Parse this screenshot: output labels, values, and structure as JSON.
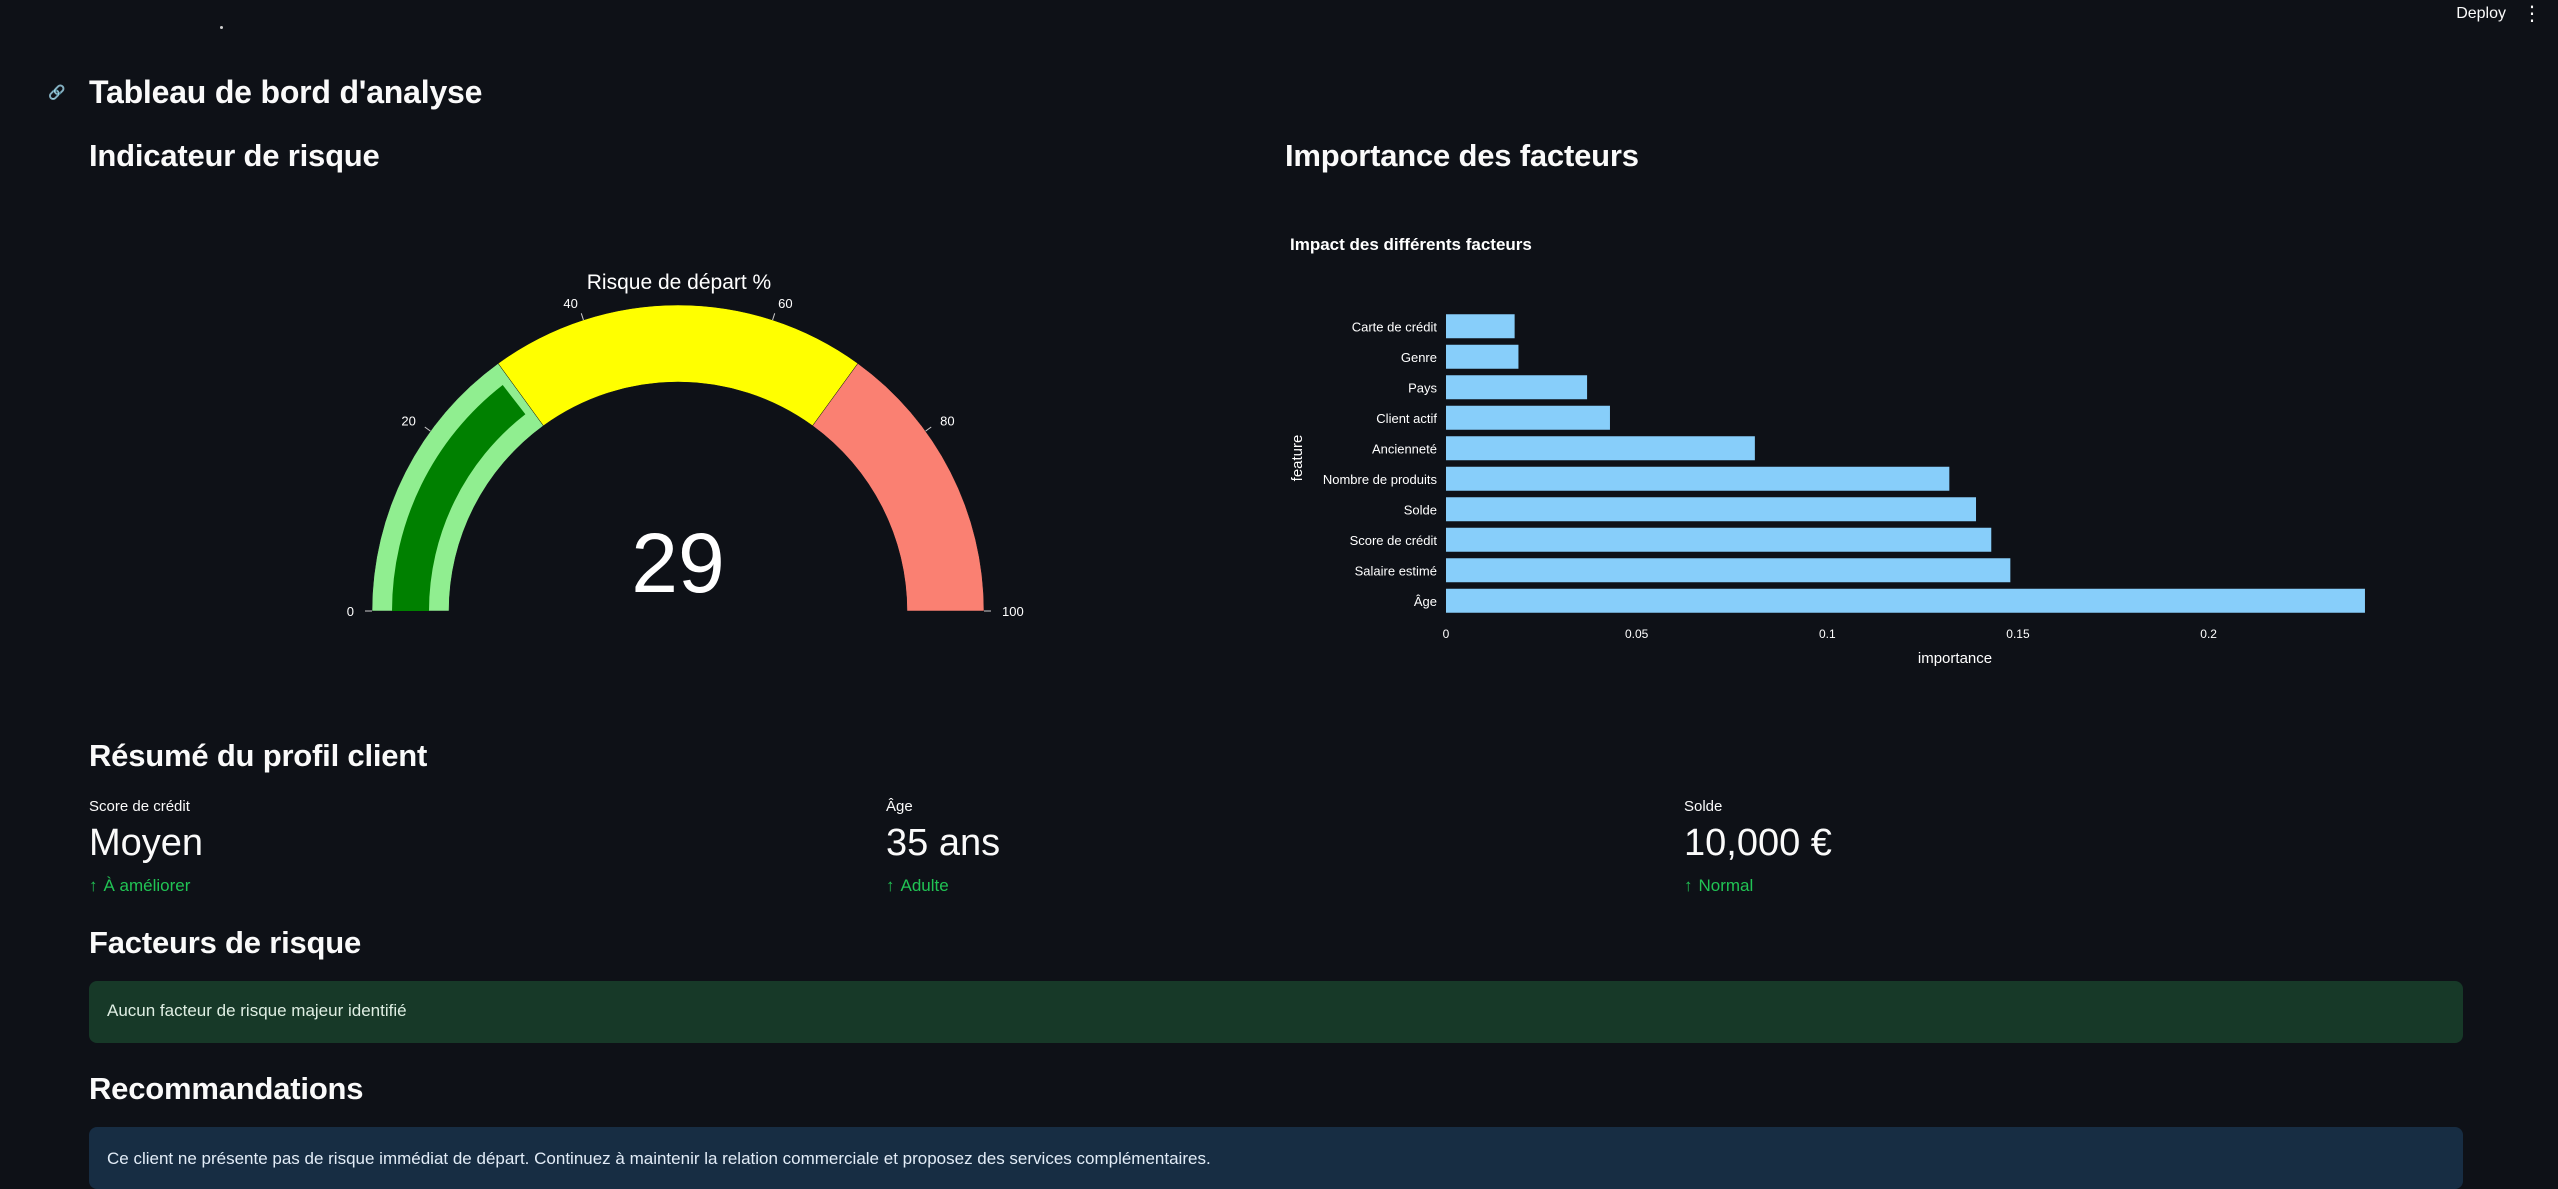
{
  "topbar": {
    "deploy_label": "Deploy",
    "menu_icon": "⋮"
  },
  "page": {
    "title": "Tableau de bord d'analyse"
  },
  "sections": {
    "risk": "Indicateur de risque",
    "importance": "Importance des facteurs",
    "profile": "Résumé du profil client",
    "risk_factors": "Facteurs de risque",
    "recommendations": "Recommandations"
  },
  "gauge": {
    "title": "Risque de départ %",
    "value": 29,
    "value_label": "29",
    "range": [
      0,
      100
    ],
    "ticks": [
      "0",
      "20",
      "40",
      "60",
      "80",
      "100"
    ],
    "tick_values": [
      0,
      20,
      40,
      60,
      80,
      100
    ],
    "bands": [
      {
        "from": 0,
        "to": 30,
        "color": "#90ee90"
      },
      {
        "from": 30,
        "to": 70,
        "color": "#ffff00"
      },
      {
        "from": 70,
        "to": 100,
        "color": "#fa8072"
      }
    ],
    "bar_color": "#008000"
  },
  "chart_data": {
    "type": "bar",
    "orientation": "horizontal",
    "title": "Impact des différents facteurs",
    "xlabel": "importance",
    "ylabel": "feature",
    "categories": [
      "Carte de crédit",
      "Genre",
      "Pays",
      "Client actif",
      "Ancienneté",
      "Nombre de produits",
      "Solde",
      "Score de crédit",
      "Salaire estimé",
      "Âge"
    ],
    "values": [
      0.018,
      0.019,
      0.037,
      0.043,
      0.081,
      0.132,
      0.139,
      0.143,
      0.148,
      0.241
    ],
    "xticks": [
      "0",
      "0.05",
      "0.1",
      "0.15",
      "0.2"
    ],
    "xtick_values": [
      0,
      0.05,
      0.1,
      0.15,
      0.2
    ],
    "xlim": [
      0,
      0.2536
    ],
    "bar_color": "#87cefa"
  },
  "profile": {
    "credit": {
      "label": "Score de crédit",
      "value": "Moyen",
      "delta": "À améliorer"
    },
    "age": {
      "label": "Âge",
      "value": "35 ans",
      "delta": "Adulte"
    },
    "balance": {
      "label": "Solde",
      "value": "10,000 €",
      "delta": "Normal"
    }
  },
  "alerts": {
    "risk_factors": "Aucun facteur de risque majeur identifié",
    "recommendation": "Ce client ne présente pas de risque immédiat de départ. Continuez à maintenir la relation commerciale et proposez des services complémentaires."
  }
}
